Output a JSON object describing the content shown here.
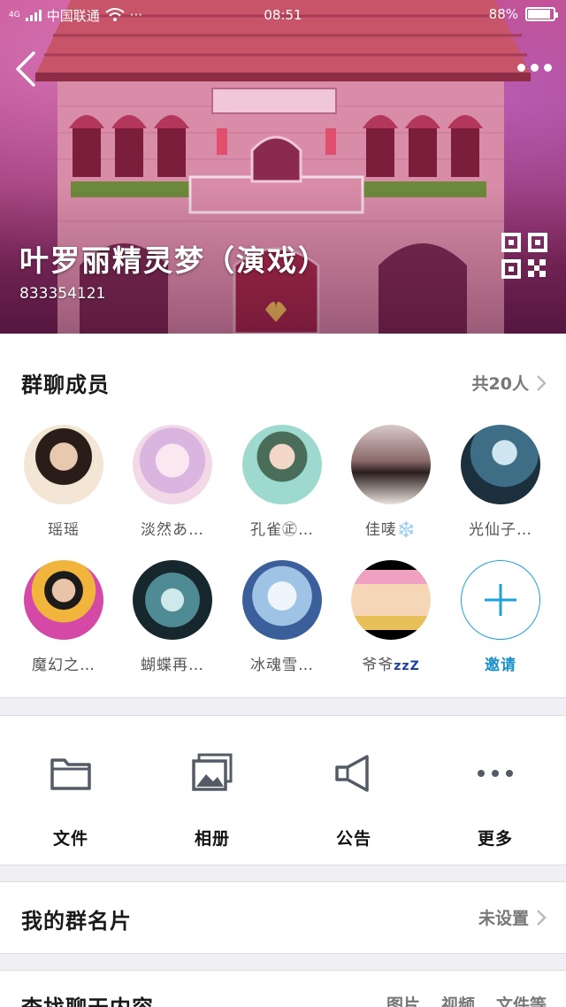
{
  "status_bar": {
    "network": "4G",
    "carrier": "中国联通",
    "extra": "···",
    "time": "08:51",
    "battery": "88%",
    "battery_level": 0.88
  },
  "header": {
    "group_name": "叶罗丽精灵梦（演戏）",
    "group_id": "833354121"
  },
  "members": {
    "title": "群聊成员",
    "count_label": "共20人",
    "items": [
      {
        "name": "瑶瑶"
      },
      {
        "name": "淡然あ…"
      },
      {
        "name": "孔雀㊣…"
      },
      {
        "name": "佳唛❄️"
      },
      {
        "name": "光仙子…"
      },
      {
        "name": "魔幻之…"
      },
      {
        "name": "蝴蝶再…"
      },
      {
        "name": "冰魂雪…"
      },
      {
        "name": "爷爷"
      },
      {
        "name": "邀请"
      }
    ],
    "zzz": "zzZ"
  },
  "tools": [
    {
      "label": "文件",
      "icon": "folder-icon"
    },
    {
      "label": "相册",
      "icon": "photo-album-icon"
    },
    {
      "label": "公告",
      "icon": "megaphone-icon"
    },
    {
      "label": "更多",
      "icon": "more-dots-icon"
    }
  ],
  "my_card": {
    "label": "我的群名片",
    "value": "未设置"
  },
  "search_chat": {
    "label": "查找聊天内容",
    "filters": [
      "图片",
      "视频",
      "文件等"
    ]
  },
  "colors": {
    "accent": "#1aa3d9",
    "banner": "#a43a78"
  }
}
